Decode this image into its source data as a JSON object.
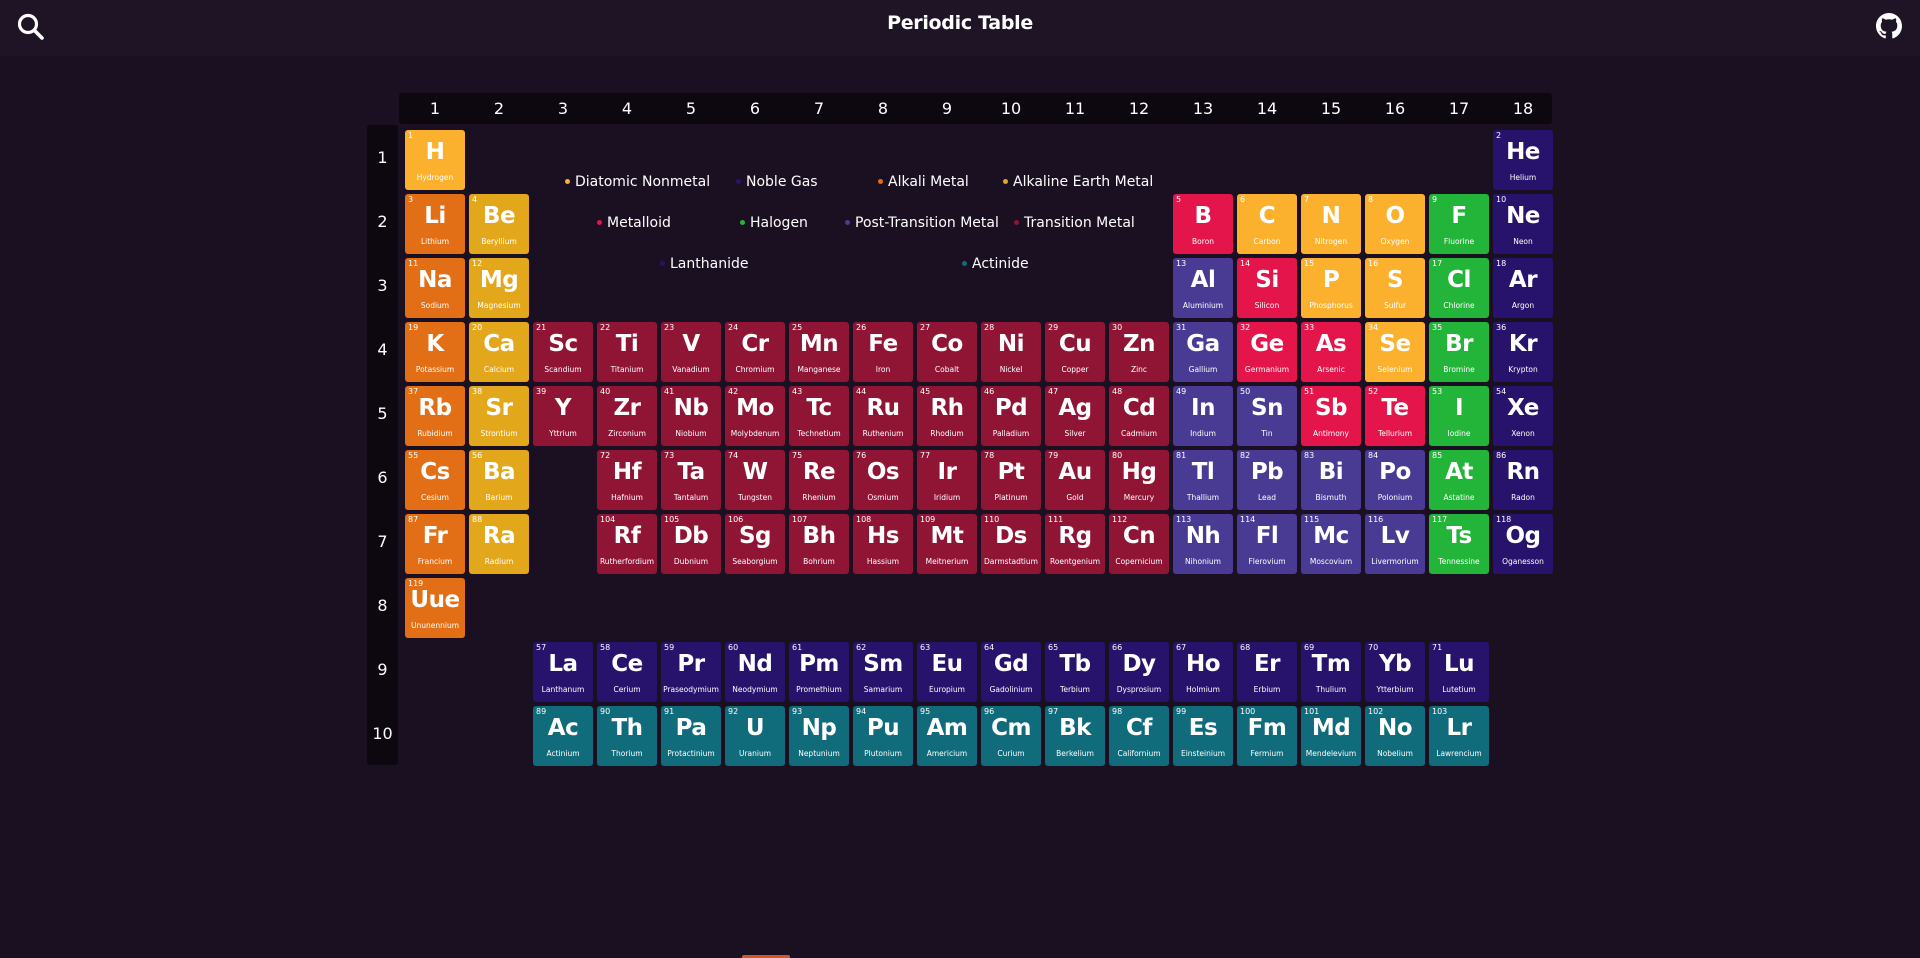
{
  "header": {
    "title": "Periodic Table",
    "search_icon": "search-icon",
    "github_icon": "github-icon"
  },
  "groups": [
    "1",
    "2",
    "3",
    "4",
    "5",
    "6",
    "7",
    "8",
    "9",
    "10",
    "11",
    "12",
    "13",
    "14",
    "15",
    "16",
    "17",
    "18"
  ],
  "periods": [
    "1",
    "2",
    "3",
    "4",
    "5",
    "6",
    "7",
    "8",
    "9",
    "10"
  ],
  "category_colors": {
    "diatomic": "#fbb12e",
    "noble": "#27136b",
    "alkali": "#e26e16",
    "alkaline": "#e3a71b",
    "metalloid": "#e3154a",
    "halogen": "#22b53a",
    "post": "#493b94",
    "transition": "#901535",
    "lanthanide": "#27136b",
    "actinide": "#106b7a"
  },
  "legend": [
    {
      "key": "diatomic",
      "label": "Diatomic Nonmetal"
    },
    {
      "key": "noble",
      "label": "Noble Gas"
    },
    {
      "key": "alkali",
      "label": "Alkali Metal"
    },
    {
      "key": "alkaline",
      "label": "Alkaline Earth Metal"
    },
    {
      "key": "metalloid",
      "label": "Metalloid"
    },
    {
      "key": "halogen",
      "label": "Halogen"
    },
    {
      "key": "post",
      "label": "Post-Transition Metal"
    },
    {
      "key": "transition",
      "label": "Transition Metal"
    },
    {
      "key": "lanthanide",
      "label": "Lanthanide"
    },
    {
      "key": "actinide",
      "label": "Actinide"
    }
  ],
  "elements": [
    {
      "n": "1",
      "s": "H",
      "name": "Hydrogen",
      "g": 1,
      "p": 1,
      "c": "diatomic"
    },
    {
      "n": "2",
      "s": "He",
      "name": "Helium",
      "g": 18,
      "p": 1,
      "c": "noble"
    },
    {
      "n": "3",
      "s": "Li",
      "name": "Lithium",
      "g": 1,
      "p": 2,
      "c": "alkali"
    },
    {
      "n": "4",
      "s": "Be",
      "name": "Beryllium",
      "g": 2,
      "p": 2,
      "c": "alkaline"
    },
    {
      "n": "5",
      "s": "B",
      "name": "Boron",
      "g": 13,
      "p": 2,
      "c": "metalloid"
    },
    {
      "n": "6",
      "s": "C",
      "name": "Carbon",
      "g": 14,
      "p": 2,
      "c": "diatomic"
    },
    {
      "n": "7",
      "s": "N",
      "name": "Nitrogen",
      "g": 15,
      "p": 2,
      "c": "diatomic"
    },
    {
      "n": "8",
      "s": "O",
      "name": "Oxygen",
      "g": 16,
      "p": 2,
      "c": "diatomic"
    },
    {
      "n": "9",
      "s": "F",
      "name": "Fluorine",
      "g": 17,
      "p": 2,
      "c": "halogen"
    },
    {
      "n": "10",
      "s": "Ne",
      "name": "Neon",
      "g": 18,
      "p": 2,
      "c": "noble"
    },
    {
      "n": "11",
      "s": "Na",
      "name": "Sodium",
      "g": 1,
      "p": 3,
      "c": "alkali"
    },
    {
      "n": "12",
      "s": "Mg",
      "name": "Magnesium",
      "g": 2,
      "p": 3,
      "c": "alkaline"
    },
    {
      "n": "13",
      "s": "Al",
      "name": "Aluminium",
      "g": 13,
      "p": 3,
      "c": "post"
    },
    {
      "n": "14",
      "s": "Si",
      "name": "Silicon",
      "g": 14,
      "p": 3,
      "c": "metalloid"
    },
    {
      "n": "15",
      "s": "P",
      "name": "Phosphorus",
      "g": 15,
      "p": 3,
      "c": "diatomic"
    },
    {
      "n": "16",
      "s": "S",
      "name": "Sulfur",
      "g": 16,
      "p": 3,
      "c": "diatomic"
    },
    {
      "n": "17",
      "s": "Cl",
      "name": "Chlorine",
      "g": 17,
      "p": 3,
      "c": "halogen"
    },
    {
      "n": "18",
      "s": "Ar",
      "name": "Argon",
      "g": 18,
      "p": 3,
      "c": "noble"
    },
    {
      "n": "19",
      "s": "K",
      "name": "Potassium",
      "g": 1,
      "p": 4,
      "c": "alkali"
    },
    {
      "n": "20",
      "s": "Ca",
      "name": "Calcium",
      "g": 2,
      "p": 4,
      "c": "alkaline"
    },
    {
      "n": "21",
      "s": "Sc",
      "name": "Scandium",
      "g": 3,
      "p": 4,
      "c": "transition"
    },
    {
      "n": "22",
      "s": "Ti",
      "name": "Titanium",
      "g": 4,
      "p": 4,
      "c": "transition"
    },
    {
      "n": "23",
      "s": "V",
      "name": "Vanadium",
      "g": 5,
      "p": 4,
      "c": "transition"
    },
    {
      "n": "24",
      "s": "Cr",
      "name": "Chromium",
      "g": 6,
      "p": 4,
      "c": "transition"
    },
    {
      "n": "25",
      "s": "Mn",
      "name": "Manganese",
      "g": 7,
      "p": 4,
      "c": "transition"
    },
    {
      "n": "26",
      "s": "Fe",
      "name": "Iron",
      "g": 8,
      "p": 4,
      "c": "transition"
    },
    {
      "n": "27",
      "s": "Co",
      "name": "Cobalt",
      "g": 9,
      "p": 4,
      "c": "transition"
    },
    {
      "n": "28",
      "s": "Ni",
      "name": "Nickel",
      "g": 10,
      "p": 4,
      "c": "transition"
    },
    {
      "n": "29",
      "s": "Cu",
      "name": "Copper",
      "g": 11,
      "p": 4,
      "c": "transition"
    },
    {
      "n": "30",
      "s": "Zn",
      "name": "Zinc",
      "g": 12,
      "p": 4,
      "c": "transition"
    },
    {
      "n": "31",
      "s": "Ga",
      "name": "Gallium",
      "g": 13,
      "p": 4,
      "c": "post"
    },
    {
      "n": "32",
      "s": "Ge",
      "name": "Germanium",
      "g": 14,
      "p": 4,
      "c": "metalloid"
    },
    {
      "n": "33",
      "s": "As",
      "name": "Arsenic",
      "g": 15,
      "p": 4,
      "c": "metalloid"
    },
    {
      "n": "34",
      "s": "Se",
      "name": "Selenium",
      "g": 16,
      "p": 4,
      "c": "diatomic"
    },
    {
      "n": "35",
      "s": "Br",
      "name": "Bromine",
      "g": 17,
      "p": 4,
      "c": "halogen"
    },
    {
      "n": "36",
      "s": "Kr",
      "name": "Krypton",
      "g": 18,
      "p": 4,
      "c": "noble"
    },
    {
      "n": "37",
      "s": "Rb",
      "name": "Rubidium",
      "g": 1,
      "p": 5,
      "c": "alkali"
    },
    {
      "n": "38",
      "s": "Sr",
      "name": "Strontium",
      "g": 2,
      "p": 5,
      "c": "alkaline"
    },
    {
      "n": "39",
      "s": "Y",
      "name": "Yttrium",
      "g": 3,
      "p": 5,
      "c": "transition"
    },
    {
      "n": "40",
      "s": "Zr",
      "name": "Zirconium",
      "g": 4,
      "p": 5,
      "c": "transition"
    },
    {
      "n": "41",
      "s": "Nb",
      "name": "Niobium",
      "g": 5,
      "p": 5,
      "c": "transition"
    },
    {
      "n": "42",
      "s": "Mo",
      "name": "Molybdenum",
      "g": 6,
      "p": 5,
      "c": "transition"
    },
    {
      "n": "43",
      "s": "Tc",
      "name": "Technetium",
      "g": 7,
      "p": 5,
      "c": "transition"
    },
    {
      "n": "44",
      "s": "Ru",
      "name": "Ruthenium",
      "g": 8,
      "p": 5,
      "c": "transition"
    },
    {
      "n": "45",
      "s": "Rh",
      "name": "Rhodium",
      "g": 9,
      "p": 5,
      "c": "transition"
    },
    {
      "n": "46",
      "s": "Pd",
      "name": "Palladium",
      "g": 10,
      "p": 5,
      "c": "transition"
    },
    {
      "n": "47",
      "s": "Ag",
      "name": "Silver",
      "g": 11,
      "p": 5,
      "c": "transition"
    },
    {
      "n": "48",
      "s": "Cd",
      "name": "Cadmium",
      "g": 12,
      "p": 5,
      "c": "transition"
    },
    {
      "n": "49",
      "s": "In",
      "name": "Indium",
      "g": 13,
      "p": 5,
      "c": "post"
    },
    {
      "n": "50",
      "s": "Sn",
      "name": "Tin",
      "g": 14,
      "p": 5,
      "c": "post"
    },
    {
      "n": "51",
      "s": "Sb",
      "name": "Antimony",
      "g": 15,
      "p": 5,
      "c": "metalloid"
    },
    {
      "n": "52",
      "s": "Te",
      "name": "Tellurium",
      "g": 16,
      "p": 5,
      "c": "metalloid"
    },
    {
      "n": "53",
      "s": "I",
      "name": "Iodine",
      "g": 17,
      "p": 5,
      "c": "halogen"
    },
    {
      "n": "54",
      "s": "Xe",
      "name": "Xenon",
      "g": 18,
      "p": 5,
      "c": "noble"
    },
    {
      "n": "55",
      "s": "Cs",
      "name": "Cesium",
      "g": 1,
      "p": 6,
      "c": "alkali"
    },
    {
      "n": "56",
      "s": "Ba",
      "name": "Barium",
      "g": 2,
      "p": 6,
      "c": "alkaline"
    },
    {
      "n": "72",
      "s": "Hf",
      "name": "Hafnium",
      "g": 4,
      "p": 6,
      "c": "transition"
    },
    {
      "n": "73",
      "s": "Ta",
      "name": "Tantalum",
      "g": 5,
      "p": 6,
      "c": "transition"
    },
    {
      "n": "74",
      "s": "W",
      "name": "Tungsten",
      "g": 6,
      "p": 6,
      "c": "transition"
    },
    {
      "n": "75",
      "s": "Re",
      "name": "Rhenium",
      "g": 7,
      "p": 6,
      "c": "transition"
    },
    {
      "n": "76",
      "s": "Os",
      "name": "Osmium",
      "g": 8,
      "p": 6,
      "c": "transition"
    },
    {
      "n": "77",
      "s": "Ir",
      "name": "Iridium",
      "g": 9,
      "p": 6,
      "c": "transition"
    },
    {
      "n": "78",
      "s": "Pt",
      "name": "Platinum",
      "g": 10,
      "p": 6,
      "c": "transition"
    },
    {
      "n": "79",
      "s": "Au",
      "name": "Gold",
      "g": 11,
      "p": 6,
      "c": "transition"
    },
    {
      "n": "80",
      "s": "Hg",
      "name": "Mercury",
      "g": 12,
      "p": 6,
      "c": "transition"
    },
    {
      "n": "81",
      "s": "Tl",
      "name": "Thallium",
      "g": 13,
      "p": 6,
      "c": "post"
    },
    {
      "n": "82",
      "s": "Pb",
      "name": "Lead",
      "g": 14,
      "p": 6,
      "c": "post"
    },
    {
      "n": "83",
      "s": "Bi",
      "name": "Bismuth",
      "g": 15,
      "p": 6,
      "c": "post"
    },
    {
      "n": "84",
      "s": "Po",
      "name": "Polonium",
      "g": 16,
      "p": 6,
      "c": "post"
    },
    {
      "n": "85",
      "s": "At",
      "name": "Astatine",
      "g": 17,
      "p": 6,
      "c": "halogen"
    },
    {
      "n": "86",
      "s": "Rn",
      "name": "Radon",
      "g": 18,
      "p": 6,
      "c": "noble"
    },
    {
      "n": "87",
      "s": "Fr",
      "name": "Francium",
      "g": 1,
      "p": 7,
      "c": "alkali"
    },
    {
      "n": "88",
      "s": "Ra",
      "name": "Radium",
      "g": 2,
      "p": 7,
      "c": "alkaline"
    },
    {
      "n": "104",
      "s": "Rf",
      "name": "Rutherfordium",
      "g": 4,
      "p": 7,
      "c": "transition"
    },
    {
      "n": "105",
      "s": "Db",
      "name": "Dubnium",
      "g": 5,
      "p": 7,
      "c": "transition"
    },
    {
      "n": "106",
      "s": "Sg",
      "name": "Seaborgium",
      "g": 6,
      "p": 7,
      "c": "transition"
    },
    {
      "n": "107",
      "s": "Bh",
      "name": "Bohrium",
      "g": 7,
      "p": 7,
      "c": "transition"
    },
    {
      "n": "108",
      "s": "Hs",
      "name": "Hassium",
      "g": 8,
      "p": 7,
      "c": "transition"
    },
    {
      "n": "109",
      "s": "Mt",
      "name": "Meitnerium",
      "g": 9,
      "p": 7,
      "c": "transition"
    },
    {
      "n": "110",
      "s": "Ds",
      "name": "Darmstadtium",
      "g": 10,
      "p": 7,
      "c": "transition"
    },
    {
      "n": "111",
      "s": "Rg",
      "name": "Roentgenium",
      "g": 11,
      "p": 7,
      "c": "transition"
    },
    {
      "n": "112",
      "s": "Cn",
      "name": "Copernicium",
      "g": 12,
      "p": 7,
      "c": "transition"
    },
    {
      "n": "113",
      "s": "Nh",
      "name": "Nihonium",
      "g": 13,
      "p": 7,
      "c": "post"
    },
    {
      "n": "114",
      "s": "Fl",
      "name": "Flerovium",
      "g": 14,
      "p": 7,
      "c": "post"
    },
    {
      "n": "115",
      "s": "Mc",
      "name": "Moscovium",
      "g": 15,
      "p": 7,
      "c": "post"
    },
    {
      "n": "116",
      "s": "Lv",
      "name": "Livermorium",
      "g": 16,
      "p": 7,
      "c": "post"
    },
    {
      "n": "117",
      "s": "Ts",
      "name": "Tennessine",
      "g": 17,
      "p": 7,
      "c": "halogen"
    },
    {
      "n": "118",
      "s": "Og",
      "name": "Oganesson",
      "g": 18,
      "p": 7,
      "c": "noble"
    },
    {
      "n": "119",
      "s": "Uue",
      "name": "Ununennium",
      "g": 1,
      "p": 8,
      "c": "alkali"
    },
    {
      "n": "57",
      "s": "La",
      "name": "Lanthanum",
      "g": 3,
      "p": 9,
      "c": "lanthanide"
    },
    {
      "n": "58",
      "s": "Ce",
      "name": "Cerium",
      "g": 4,
      "p": 9,
      "c": "lanthanide"
    },
    {
      "n": "59",
      "s": "Pr",
      "name": "Praseodymium",
      "g": 5,
      "p": 9,
      "c": "lanthanide"
    },
    {
      "n": "60",
      "s": "Nd",
      "name": "Neodymium",
      "g": 6,
      "p": 9,
      "c": "lanthanide"
    },
    {
      "n": "61",
      "s": "Pm",
      "name": "Promethium",
      "g": 7,
      "p": 9,
      "c": "lanthanide"
    },
    {
      "n": "62",
      "s": "Sm",
      "name": "Samarium",
      "g": 8,
      "p": 9,
      "c": "lanthanide"
    },
    {
      "n": "63",
      "s": "Eu",
      "name": "Europium",
      "g": 9,
      "p": 9,
      "c": "lanthanide"
    },
    {
      "n": "64",
      "s": "Gd",
      "name": "Gadolinium",
      "g": 10,
      "p": 9,
      "c": "lanthanide"
    },
    {
      "n": "65",
      "s": "Tb",
      "name": "Terbium",
      "g": 11,
      "p": 9,
      "c": "lanthanide"
    },
    {
      "n": "66",
      "s": "Dy",
      "name": "Dysprosium",
      "g": 12,
      "p": 9,
      "c": "lanthanide"
    },
    {
      "n": "67",
      "s": "Ho",
      "name": "Holmium",
      "g": 13,
      "p": 9,
      "c": "lanthanide"
    },
    {
      "n": "68",
      "s": "Er",
      "name": "Erbium",
      "g": 14,
      "p": 9,
      "c": "lanthanide"
    },
    {
      "n": "69",
      "s": "Tm",
      "name": "Thulium",
      "g": 15,
      "p": 9,
      "c": "lanthanide"
    },
    {
      "n": "70",
      "s": "Yb",
      "name": "Ytterbium",
      "g": 16,
      "p": 9,
      "c": "lanthanide"
    },
    {
      "n": "71",
      "s": "Lu",
      "name": "Lutetium",
      "g": 17,
      "p": 9,
      "c": "lanthanide"
    },
    {
      "n": "89",
      "s": "Ac",
      "name": "Actinium",
      "g": 3,
      "p": 10,
      "c": "actinide"
    },
    {
      "n": "90",
      "s": "Th",
      "name": "Thorium",
      "g": 4,
      "p": 10,
      "c": "actinide"
    },
    {
      "n": "91",
      "s": "Pa",
      "name": "Protactinium",
      "g": 5,
      "p": 10,
      "c": "actinide"
    },
    {
      "n": "92",
      "s": "U",
      "name": "Uranium",
      "g": 6,
      "p": 10,
      "c": "actinide"
    },
    {
      "n": "93",
      "s": "Np",
      "name": "Neptunium",
      "g": 7,
      "p": 10,
      "c": "actinide"
    },
    {
      "n": "94",
      "s": "Pu",
      "name": "Plutonium",
      "g": 8,
      "p": 10,
      "c": "actinide"
    },
    {
      "n": "95",
      "s": "Am",
      "name": "Americium",
      "g": 9,
      "p": 10,
      "c": "actinide"
    },
    {
      "n": "96",
      "s": "Cm",
      "name": "Curium",
      "g": 10,
      "p": 10,
      "c": "actinide"
    },
    {
      "n": "97",
      "s": "Bk",
      "name": "Berkelium",
      "g": 11,
      "p": 10,
      "c": "actinide"
    },
    {
      "n": "98",
      "s": "Cf",
      "name": "Californium",
      "g": 12,
      "p": 10,
      "c": "actinide"
    },
    {
      "n": "99",
      "s": "Es",
      "name": "Einsteinium",
      "g": 13,
      "p": 10,
      "c": "actinide"
    },
    {
      "n": "100",
      "s": "Fm",
      "name": "Fermium",
      "g": 14,
      "p": 10,
      "c": "actinide"
    },
    {
      "n": "101",
      "s": "Md",
      "name": "Mendelevium",
      "g": 15,
      "p": 10,
      "c": "actinide"
    },
    {
      "n": "102",
      "s": "No",
      "name": "Nobelium",
      "g": 16,
      "p": 10,
      "c": "actinide"
    },
    {
      "n": "103",
      "s": "Lr",
      "name": "Lawrencium",
      "g": 17,
      "p": 10,
      "c": "actinide"
    }
  ]
}
